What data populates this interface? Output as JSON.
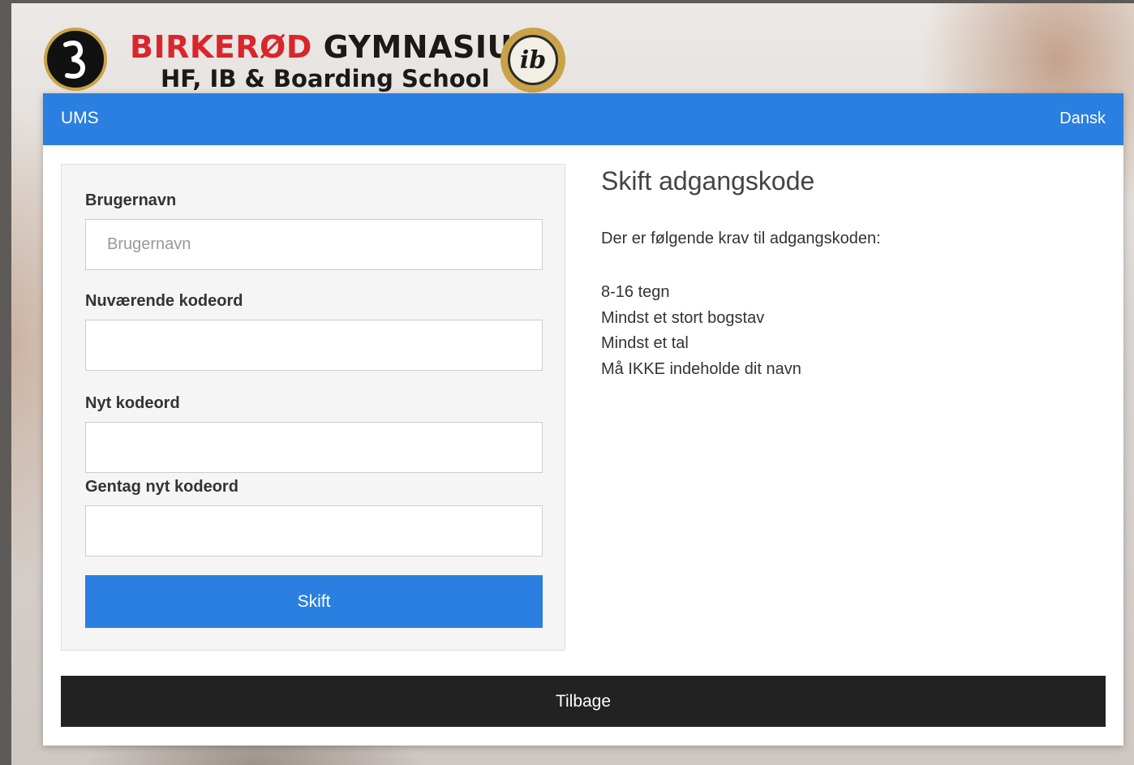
{
  "header": {
    "brand_part1": "BIRKERØD",
    "brand_part2": "GYMNASIUM",
    "subtitle": "HF, IB & Boarding School",
    "ib_logo_text": "ib",
    "colors": {
      "brand_red": "#d9262c",
      "logo_gold": "#c9a24a"
    }
  },
  "navbar": {
    "brand": "UMS",
    "language": "Dansk",
    "color": "#2a7fe0"
  },
  "form": {
    "username_label": "Brugernavn",
    "username_placeholder": "Brugernavn",
    "username_value": "",
    "current_password_label": "Nuværende kodeord",
    "current_password_value": "",
    "new_password_label": "Nyt kodeord",
    "new_password_value": "",
    "repeat_password_label": "Gentag nyt kodeord",
    "repeat_password_value": "",
    "submit_label": "Skift"
  },
  "info": {
    "title": "Skift adgangskode",
    "intro": "Der er følgende krav til adgangskoden:",
    "requirements": [
      "8-16 tegn",
      "Mindst et stort bogstav",
      "Mindst et tal",
      "Må IKKE indeholde dit navn"
    ]
  },
  "footer": {
    "back_label": "Tilbage",
    "back_color": "#222222"
  },
  "icons": {
    "school_logo": "school-logo-icon",
    "ib_logo": "ib-logo-icon"
  }
}
